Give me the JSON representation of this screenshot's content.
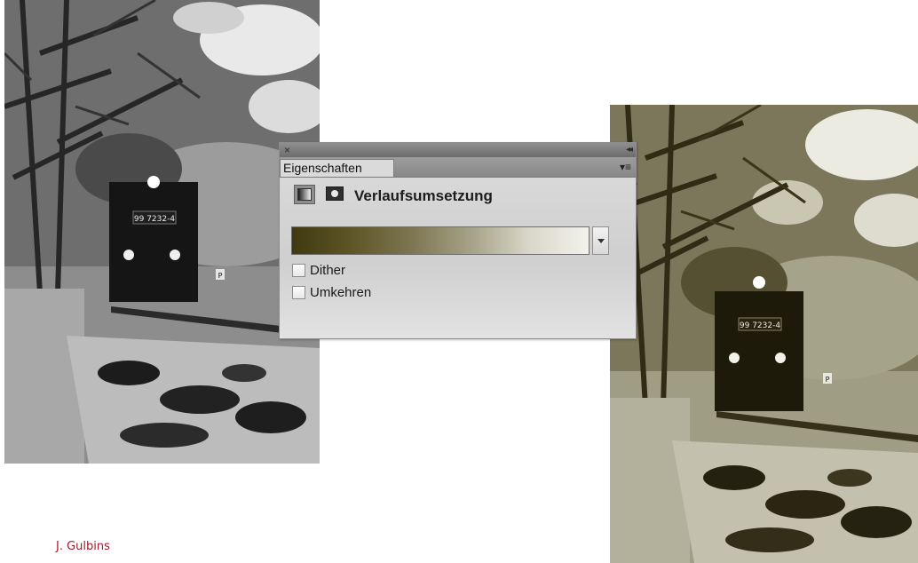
{
  "panel": {
    "close_glyph": "×",
    "collapse_glyph": "◂◂",
    "tab_label": "Eigenschaften",
    "menu_glyph": "▾≡",
    "adjustment_icon": "gradient-map-icon",
    "mask_icon": "layer-mask-icon",
    "title": "Verlaufsumsetzung",
    "gradient": {
      "stops": [
        "#3f3912",
        "#5b5224",
        "#7d7550",
        "#aaa68d",
        "#d9d7c9",
        "#f3f2ec"
      ]
    },
    "options": [
      {
        "label": "Dither",
        "checked": false
      },
      {
        "label": "Umkehren",
        "checked": false
      }
    ]
  },
  "photos": {
    "left": {
      "tone": "grayscale",
      "sign": "P",
      "plate": "99 7232-4"
    },
    "right": {
      "tone": "sepia",
      "sign": "P",
      "plate": "99 7232-4"
    }
  },
  "credit": "J. Gulbins"
}
